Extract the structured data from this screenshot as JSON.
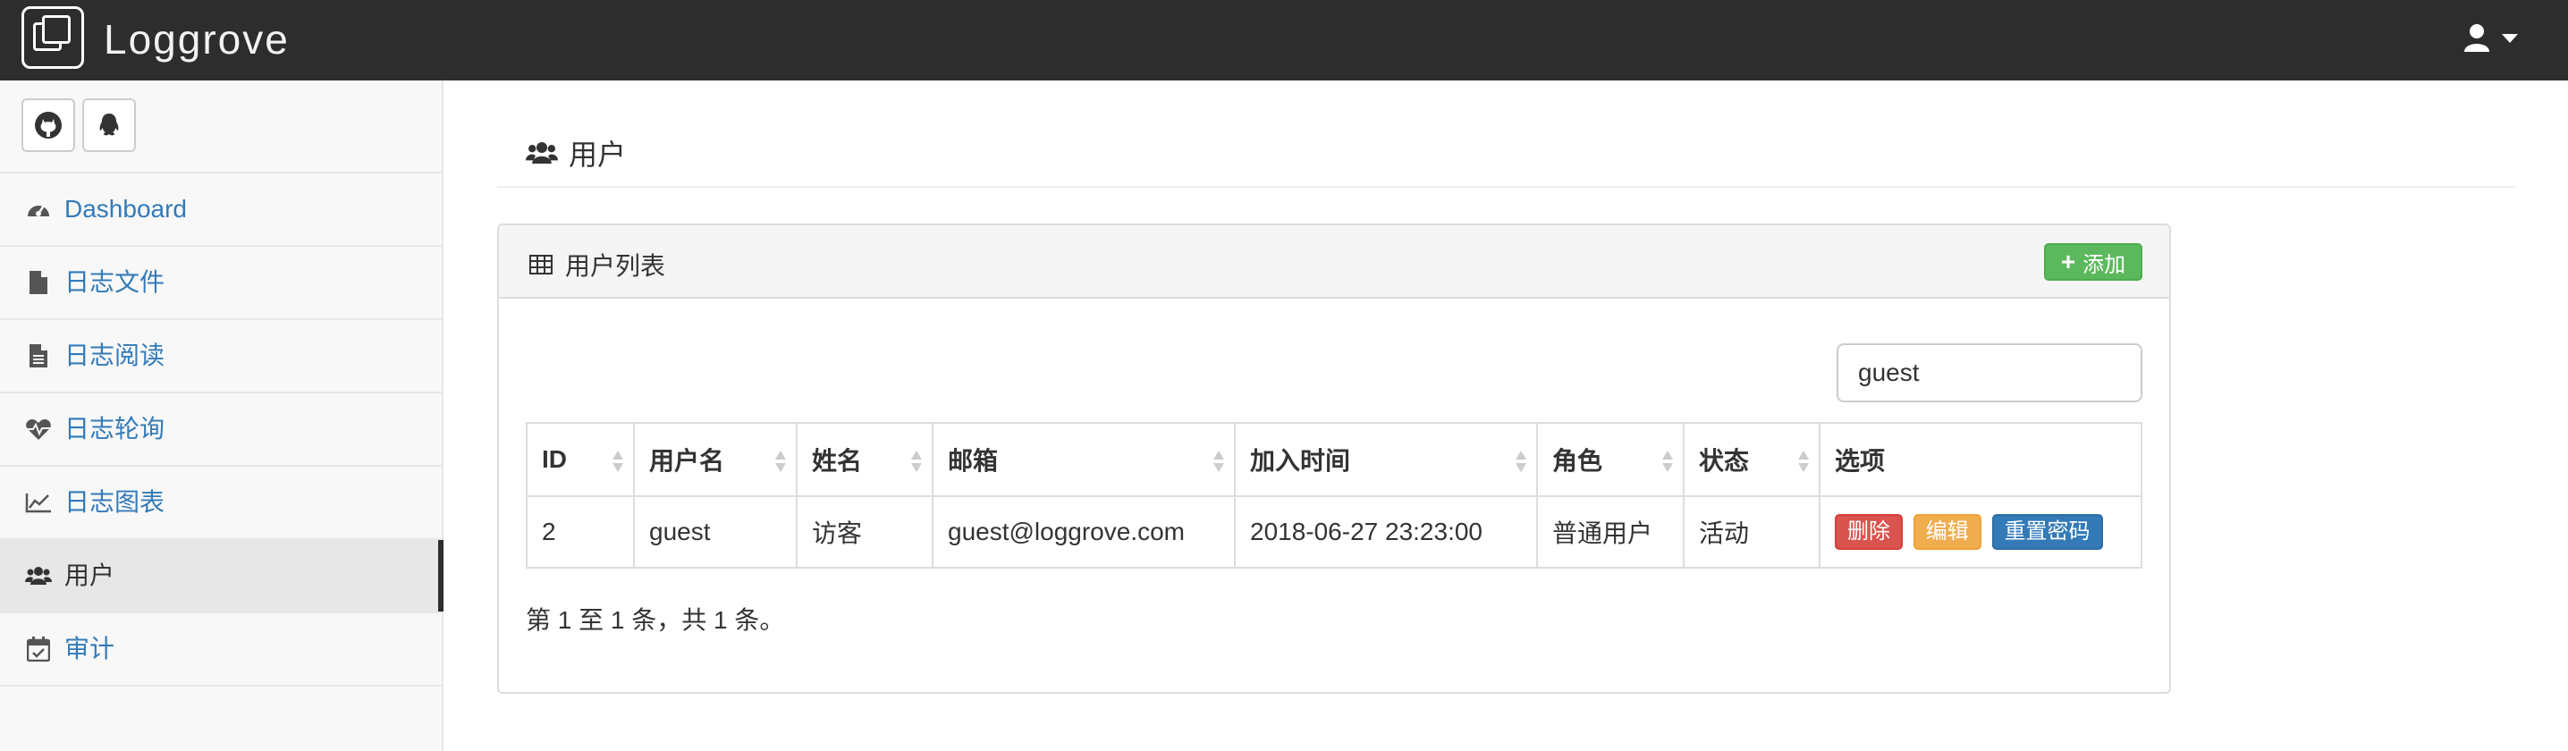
{
  "app": {
    "brand": "Loggrove"
  },
  "colors": {
    "navbar": "#2d2d2d",
    "link": "#337ab7",
    "success": "#5cb85c",
    "danger": "#d9534f",
    "warning": "#f0ad4e",
    "primary": "#337ab7"
  },
  "navbar": {
    "user_icon": "user-icon",
    "caret_icon": "caret-down-icon"
  },
  "social": [
    {
      "icon": "github-icon"
    },
    {
      "icon": "qq-icon"
    }
  ],
  "sidebar": {
    "items": [
      {
        "label": "Dashboard",
        "icon": "dashboard-icon"
      },
      {
        "label": "日志文件",
        "icon": "file-icon"
      },
      {
        "label": "日志阅读",
        "icon": "file-text-icon"
      },
      {
        "label": "日志轮询",
        "icon": "heartbeat-icon"
      },
      {
        "label": "日志图表",
        "icon": "line-chart-icon"
      },
      {
        "label": "用户",
        "icon": "users-icon",
        "active": true
      },
      {
        "label": "审计",
        "icon": "calendar-check-icon"
      }
    ]
  },
  "page": {
    "title": "用户"
  },
  "panel": {
    "title": "用户列表",
    "add_label": "添加"
  },
  "search": {
    "value": "guest"
  },
  "table": {
    "columns": [
      "ID",
      "用户名",
      "姓名",
      "邮箱",
      "加入时间",
      "角色",
      "状态",
      "选项"
    ],
    "rows": [
      {
        "id": "2",
        "username": "guest",
        "name": "访客",
        "email": "guest@loggrove.com",
        "joined": "2018-06-27 23:23:00",
        "role": "普通用户",
        "status": "活动",
        "actions": {
          "delete": "删除",
          "edit": "编辑",
          "reset": "重置密码"
        }
      }
    ]
  },
  "pagination": {
    "info": "第 1 至 1 条，共 1 条。"
  }
}
